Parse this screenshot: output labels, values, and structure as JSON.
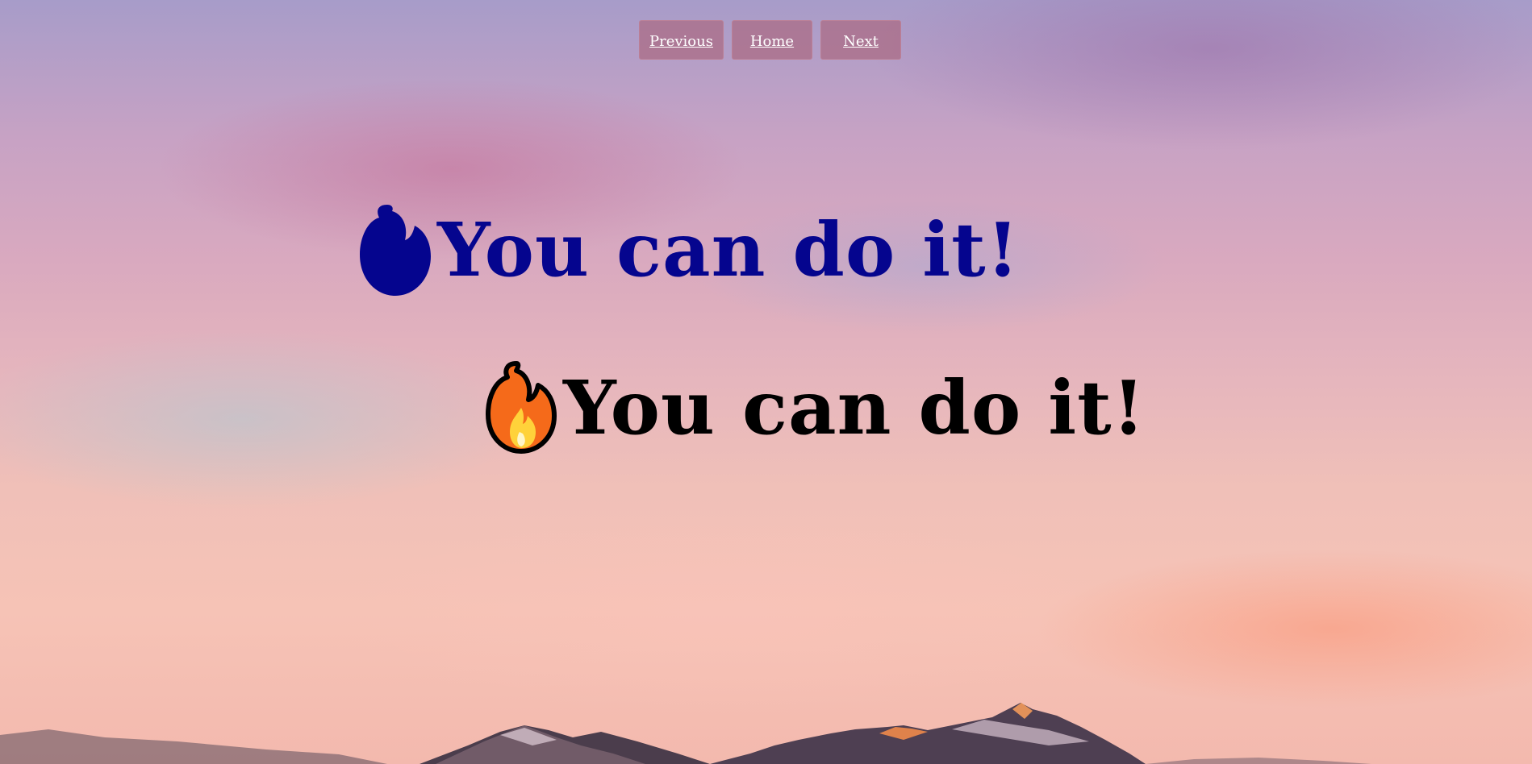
{
  "nav": {
    "previous_label": "Previous",
    "home_label": "Home",
    "next_label": "Next"
  },
  "headlines": [
    {
      "text": "You can do it!",
      "icon": "fire-icon",
      "color": "#05058e"
    },
    {
      "text": "You can do it!",
      "icon": "fire-emoji-icon",
      "color": "#000000"
    }
  ],
  "colors": {
    "nav_button_bg": "#aa6982",
    "fire_orange": "#f56a1a",
    "fire_yellow": "#ffd23a"
  }
}
